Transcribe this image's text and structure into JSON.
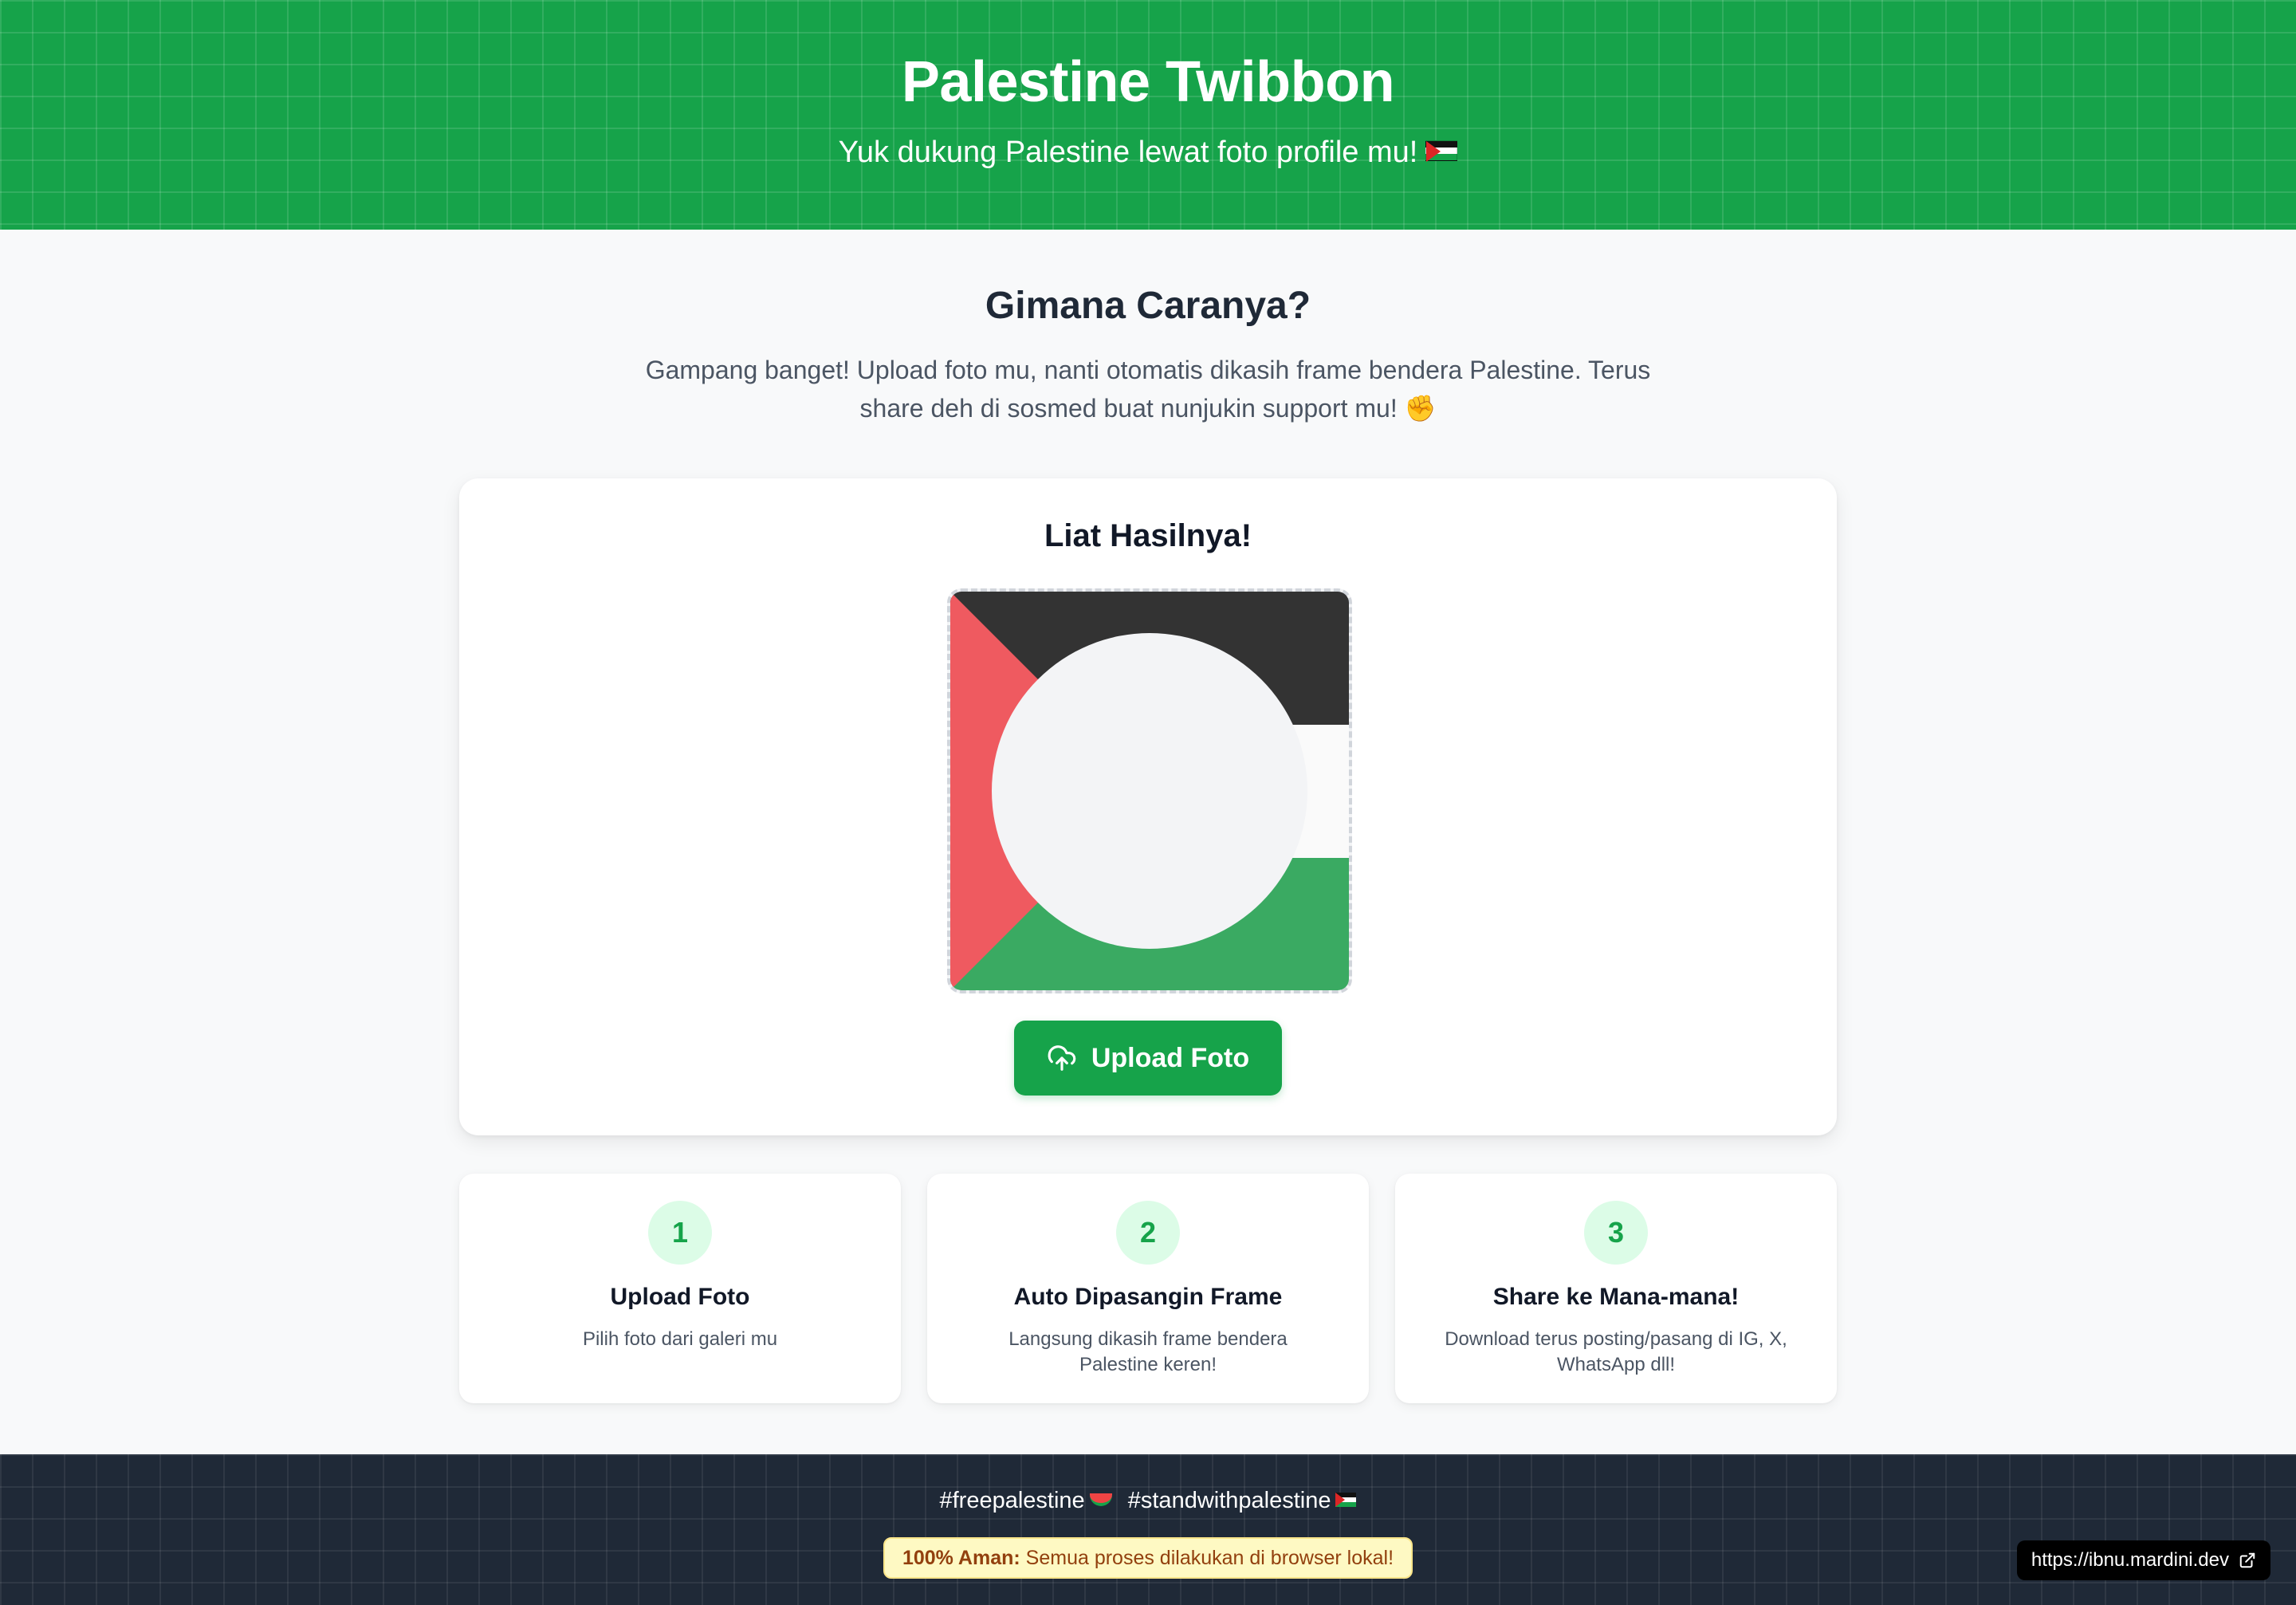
{
  "header": {
    "title": "Palestine Twibbon",
    "subtitle": "Yuk dukung Palestine lewat foto profile mu!"
  },
  "intro": {
    "title": "Gimana Caranya?",
    "text": "Gampang banget! Upload foto mu, nanti otomatis dikasih frame bendera Palestine. Terus share deh di sosmed buat nunjukin support mu! ✊"
  },
  "preview_card": {
    "title": "Liat Hasilnya!",
    "upload_label": "Upload Foto",
    "upload_icon": "cloud-upload-icon"
  },
  "steps": [
    {
      "number": "1",
      "title": "Upload Foto",
      "desc": "Pilih foto dari galeri mu"
    },
    {
      "number": "2",
      "title": "Auto Dipasangin Frame",
      "desc": "Langsung dikasih frame bendera Palestine keren!"
    },
    {
      "number": "3",
      "title": "Share ke Mana-mana!",
      "desc": "Download terus posting/pasang di IG, X, WhatsApp dll!"
    }
  ],
  "footer": {
    "hashtag_1": "#freepalestine",
    "hashtag_2": "#standwithpalestine",
    "safe_strong": "100% Aman:",
    "safe_text": "Semua proses dilakukan di browser lokal!",
    "site_link": "https://ibnu.mardini.dev"
  },
  "colors": {
    "primary_green": "#16a34a",
    "flag_black": "#333333",
    "flag_red": "#ef5a60",
    "flag_green": "#3aaa62",
    "footer_bg": "#1f2937"
  }
}
